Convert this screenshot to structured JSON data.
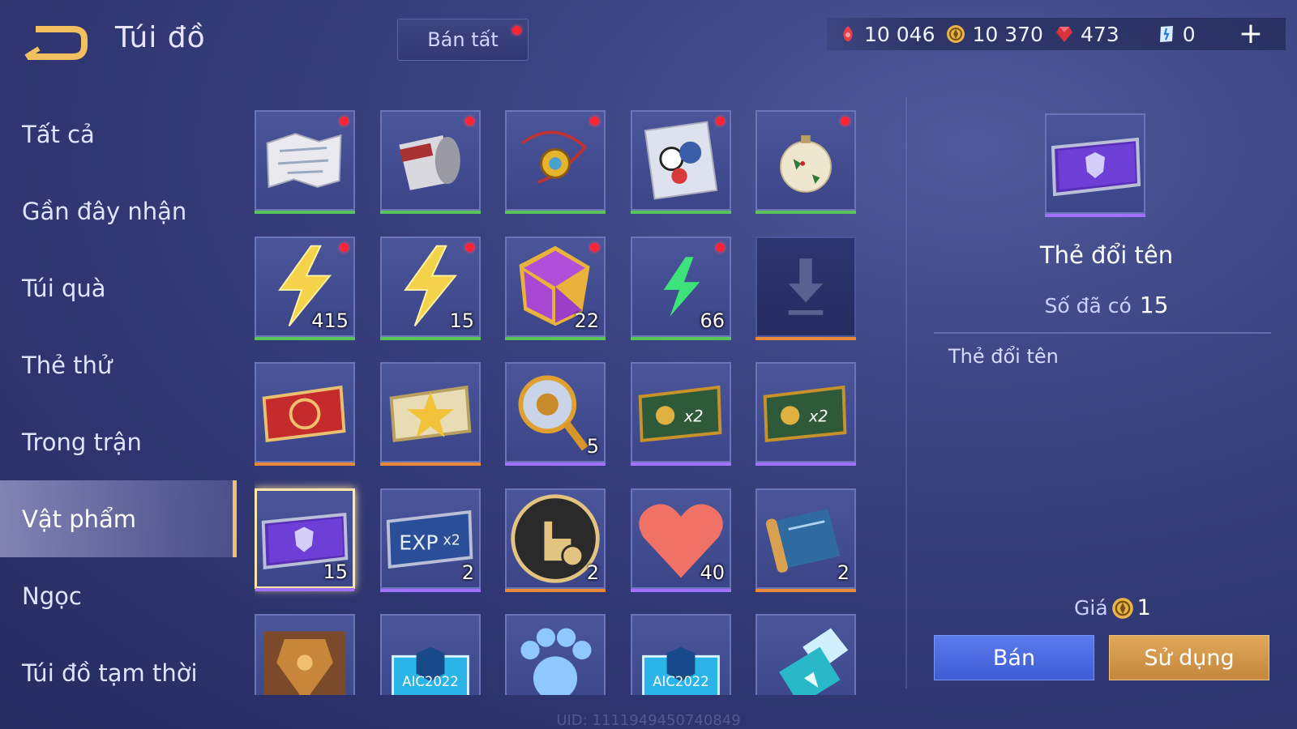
{
  "header": {
    "title": "Túi đồ",
    "sell_all_label": "Bán tất",
    "currencies": [
      {
        "icon": "red-gem-icon",
        "value": "10 046",
        "color": "#e8404a"
      },
      {
        "icon": "gold-coin-icon",
        "value": "10 370",
        "color": "#e9b54a"
      },
      {
        "icon": "ruby-icon",
        "value": "473",
        "color": "#e8404a"
      },
      {
        "icon": "blue-voucher-icon",
        "value": "0",
        "color": "#6fb6ff"
      }
    ],
    "plus_label": "+"
  },
  "sidebar": {
    "items": [
      {
        "label": "Tất cả"
      },
      {
        "label": "Gần đây nhận"
      },
      {
        "label": "Túi quà"
      },
      {
        "label": "Thẻ thử"
      },
      {
        "label": "Trong trận"
      },
      {
        "label": "Vật phẩm",
        "active": true
      },
      {
        "label": "Ngọc"
      },
      {
        "label": "Túi đồ tạm thời"
      }
    ]
  },
  "grid": {
    "items": [
      {
        "icon": "map-scroll-icon",
        "count": "",
        "new": true,
        "rarity": "#58c45a"
      },
      {
        "icon": "paper-cup-icon",
        "count": "",
        "new": true,
        "rarity": "#58c45a"
      },
      {
        "icon": "amulet-necklace-icon",
        "count": "",
        "new": true,
        "rarity": "#58c45a"
      },
      {
        "icon": "sticker-pack-icon",
        "count": "",
        "new": true,
        "rarity": "#58c45a"
      },
      {
        "icon": "christmas-ornament-icon",
        "count": "",
        "new": true,
        "rarity": "#58c45a"
      },
      {
        "icon": "gold-lightning-icon",
        "count": "415",
        "new": true,
        "rarity": "#58c45a"
      },
      {
        "icon": "gold-lightning-icon",
        "count": "15",
        "new": true,
        "rarity": "#58c45a"
      },
      {
        "icon": "dice-icon",
        "count": "22",
        "new": true,
        "rarity": "#58c45a"
      },
      {
        "icon": "green-lightning-icon",
        "count": "66",
        "new": true,
        "rarity": "#58c45a"
      },
      {
        "icon": "download-icon",
        "count": "",
        "new": false,
        "rarity": "#e88a3a",
        "empty": true
      },
      {
        "icon": "red-ticket-icon",
        "count": "",
        "new": false,
        "rarity": "#e88a3a"
      },
      {
        "icon": "star-badge-icon",
        "count": "",
        "new": false,
        "rarity": "#e88a3a"
      },
      {
        "icon": "golden-scepter-icon",
        "count": "5",
        "new": false,
        "rarity": "#a070ff"
      },
      {
        "icon": "x2-gold-card-icon",
        "count": "",
        "new": false,
        "rarity": "#a070ff"
      },
      {
        "icon": "x2-gold-card-icon",
        "count": "",
        "new": false,
        "rarity": "#a070ff"
      },
      {
        "icon": "rename-card-icon",
        "count": "15",
        "new": false,
        "rarity": "#a070ff",
        "selected": true
      },
      {
        "icon": "exp-x2-card-icon",
        "count": "2",
        "new": false,
        "rarity": "#a070ff"
      },
      {
        "icon": "tap-confirm-icon",
        "count": "2",
        "new": false,
        "rarity": "#e88a3a"
      },
      {
        "icon": "heart-icon",
        "count": "40",
        "new": false,
        "rarity": "#a070ff"
      },
      {
        "icon": "map-scroll-blue-icon",
        "count": "2",
        "new": false,
        "rarity": "#e88a3a"
      },
      {
        "icon": "armor-chest-icon",
        "count": "",
        "new": false,
        "rarity": "#e88a3a"
      },
      {
        "icon": "aic2022-ticket-icon",
        "count": "",
        "new": false,
        "rarity": "#a070ff",
        "label": "AIC2022"
      },
      {
        "icon": "paw-icon",
        "count": "",
        "new": false,
        "rarity": "#a070ff"
      },
      {
        "icon": "aic2022-ticket-icon",
        "count": "",
        "new": false,
        "rarity": "#a070ff",
        "label": "AIC2022"
      },
      {
        "icon": "soda-can-icon",
        "count": "",
        "new": false,
        "rarity": "#a070ff"
      }
    ]
  },
  "detail": {
    "icon": "rename-card-icon",
    "name": "Thẻ đổi tên",
    "owned_label": "Số đã có",
    "owned_value": "15",
    "description": "Thẻ đổi tên",
    "price_label": "Giá",
    "price_icon": "gold-coin-icon",
    "price_value": "1",
    "sell_label": "Bán",
    "use_label": "Sử dụng"
  },
  "footer": {
    "uid": "UID: 1111949450740849"
  }
}
